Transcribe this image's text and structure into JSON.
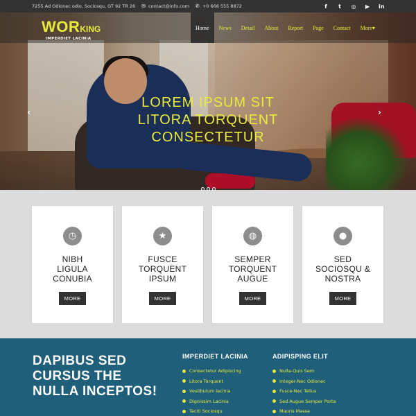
{
  "topbar": {
    "address": "7255 Ad Odionec odio, Sociosqu, GT 92 TR 26",
    "email": "contact@info.com",
    "phone": "+0 666 555 8872",
    "social_icons": [
      "facebook-icon",
      "twitter-icon",
      "instagram-icon",
      "youtube-icon",
      "linkedin-icon"
    ]
  },
  "logo": {
    "main": "WOR",
    "suffix": "KING",
    "tagline": "IMPERDIET LACINIA"
  },
  "nav": {
    "items": [
      {
        "label": "Home"
      },
      {
        "label": "News"
      },
      {
        "label": "Detail"
      },
      {
        "label": "About"
      },
      {
        "label": "Report"
      },
      {
        "label": "Page"
      },
      {
        "label": "Contact"
      },
      {
        "label": "More▾"
      }
    ],
    "active_index": 0
  },
  "hero": {
    "line1": "LOREM IPSUM SIT",
    "line2": "LITORA TORQUENT",
    "line3": "CONSECTETUR",
    "slide_count": 3
  },
  "services": [
    {
      "title": "NIBH\nLIGULA\nCONUBIA",
      "icon": "clock-icon",
      "button": "MORE"
    },
    {
      "title": "FUSCE\nTORQUENT\nIPSUM",
      "icon": "star-icon",
      "button": "MORE"
    },
    {
      "title": "SEMPER\nTORQUENT\nAUGUE",
      "icon": "globe-icon",
      "button": "MORE"
    },
    {
      "title": "SED\nSOCIOSQU &\nNOSTRA",
      "icon": "user-icon",
      "button": "MORE"
    }
  ],
  "footer": {
    "headline": "DAPIBUS SED CURSUS THE NULLA INCEPTOS!",
    "col1": {
      "title": "IMPERDIET LACINIA",
      "items": [
        "Consectetur Adipiscing",
        "Litora Torquent",
        "Vestibulum lacinia",
        "Dignissim Lacinia",
        "Taciti Sociosqu"
      ]
    },
    "col2": {
      "title": "ADIPISPING ELIT",
      "items": [
        "Nulla-Quis Sem",
        "Integer-Nec Odionec",
        "Fusce-Nec Tellus",
        "Sed Augue Semper Porta",
        "Mauris Massa"
      ]
    }
  },
  "colors": {
    "accent": "#e8eb3b",
    "footer_bg": "#1f5f7a",
    "topbar_bg": "#333333",
    "section_bg": "#dcdcdc"
  }
}
